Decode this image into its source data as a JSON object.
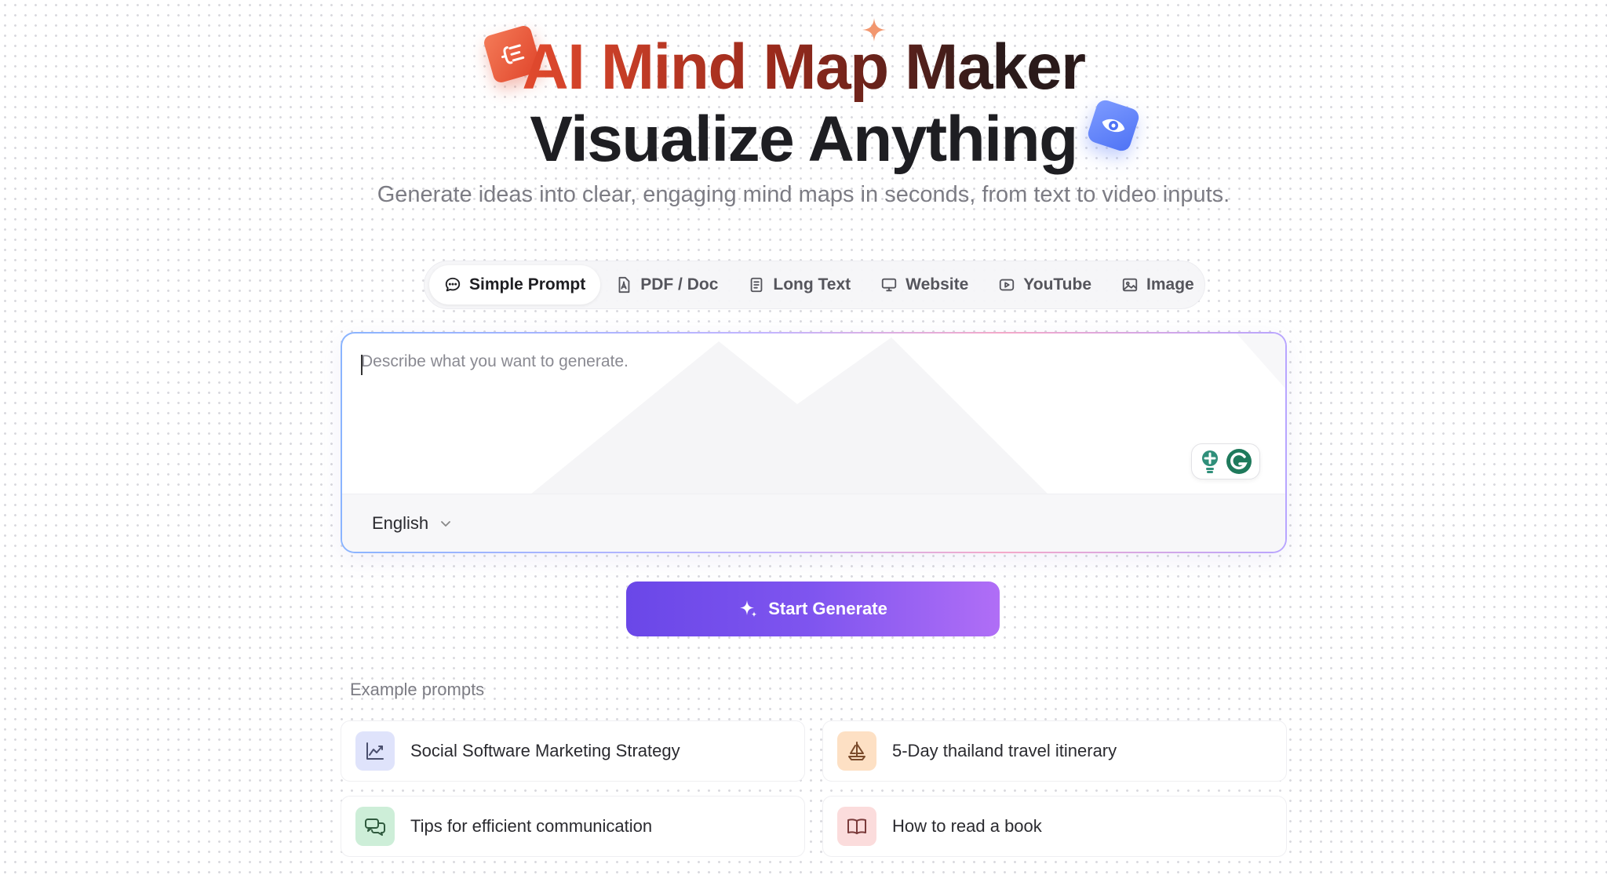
{
  "hero": {
    "title_line1": "AI Mind Map Maker",
    "title_line2": "Visualize Anything",
    "subtitle": "Generate ideas into clear, engaging mind maps in seconds, from text to video inputs."
  },
  "tabs": [
    {
      "label": "Simple Prompt",
      "icon": "chat-bubble-icon",
      "active": true
    },
    {
      "label": "PDF / Doc",
      "icon": "pdf-file-icon",
      "active": false
    },
    {
      "label": "Long Text",
      "icon": "text-document-icon",
      "active": false
    },
    {
      "label": "Website",
      "icon": "monitor-icon",
      "active": false
    },
    {
      "label": "YouTube",
      "icon": "play-video-icon",
      "active": false
    },
    {
      "label": "Image",
      "icon": "image-icon",
      "active": false
    }
  ],
  "prompt": {
    "placeholder": "Describe what you want to generate.",
    "value": "",
    "language": "English"
  },
  "generate_button": {
    "label": "Start Generate"
  },
  "examples": {
    "label": "Example prompts",
    "items": [
      {
        "text": "Social Software Marketing Strategy",
        "icon": "chart-trend-icon",
        "color": "#dfe3fb"
      },
      {
        "text": "5-Day thailand travel itinerary",
        "icon": "sailboat-icon",
        "color": "#fde0c4"
      },
      {
        "text": "Tips for efficient communication",
        "icon": "chat-bubbles-icon",
        "color": "#cdeed8"
      },
      {
        "text": "How to read a book",
        "icon": "open-book-icon",
        "color": "#fbdcdc"
      }
    ]
  },
  "colors": {
    "accent_start": "#6a47e8",
    "accent_end": "#b06ef6",
    "title_red": "#e24a2e"
  }
}
